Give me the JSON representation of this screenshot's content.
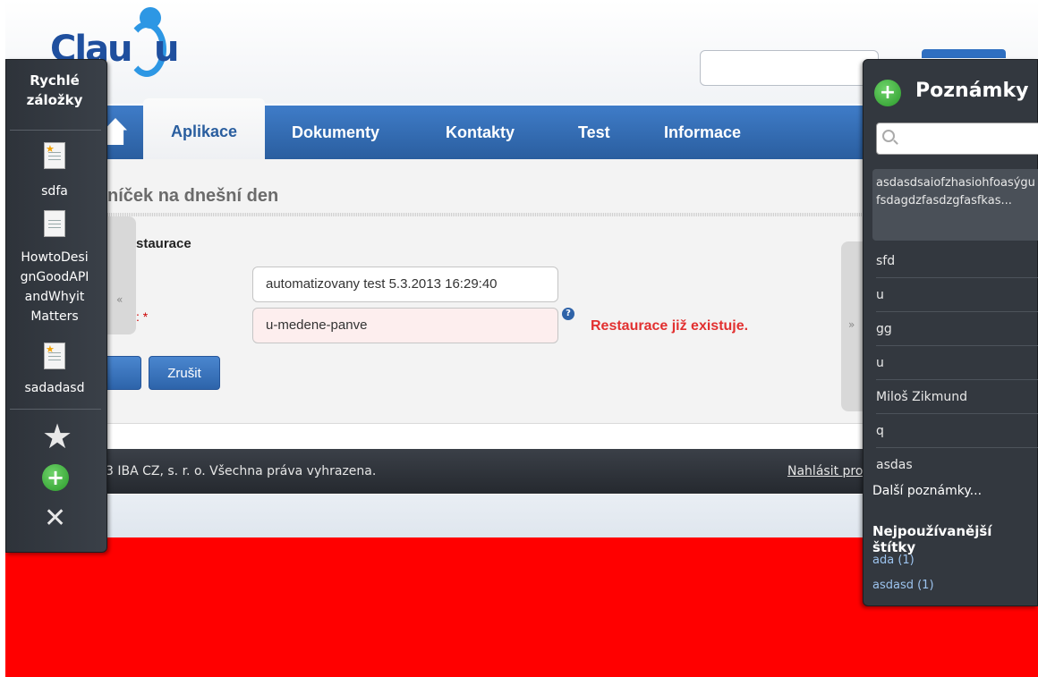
{
  "logo": {
    "text_left": "Clau",
    "text_right": "u"
  },
  "nav": {
    "tabs": [
      {
        "label": "Aplikace"
      },
      {
        "label": "Dokumenty"
      },
      {
        "label": "Kontakty"
      },
      {
        "label": "Test"
      },
      {
        "label": "Informace"
      }
    ]
  },
  "main": {
    "title": "níček na dnešní den",
    "section": "staurace",
    "required_suffix": ":",
    "required_mark": "*",
    "collapse_left_glyph": "«",
    "collapse_right_glyph": "»",
    "name_value": "automatizovany test 5.3.2013 16:29:40",
    "url_value": "u-medene-panve",
    "help_glyph": "?",
    "error_message": "Restaurace již existuje.",
    "cancel_label": "Zrušit"
  },
  "footer": {
    "copyright": "3 IBA CZ, s. r. o. Všechna práva vyhrazena.",
    "report_link": "Nahlásit pro"
  },
  "quick_bookmarks": {
    "title_line1": "Rychlé",
    "title_line2": "záložky",
    "items": [
      {
        "label": "sdfa",
        "icon": "starred-document-icon"
      },
      {
        "label_lines": [
          "HowtoDesi",
          "gnGoodAPI",
          "andWhyit",
          "Matters"
        ],
        "icon": "document-icon"
      },
      {
        "label": "sadadasd",
        "icon": "starred-document-icon"
      }
    ],
    "tools": [
      "star-icon",
      "add-icon",
      "tools-icon"
    ]
  },
  "notes": {
    "title": "Poznámky",
    "first_note": "asdasdsaiofzhasiohfoasýgufsdagdzfasdzgfasfkas...",
    "items": [
      "sfd",
      "u",
      "gg",
      "u",
      "Miloš Zikmund",
      "q",
      "asdas"
    ],
    "more_label": "Další poznámky...",
    "tags_title": "Nejpoužívanější štítky",
    "tags": [
      "ada (1)",
      "asdasd (1)"
    ]
  },
  "colors": {
    "nav_blue": "#3f7cc8",
    "error_red": "#e23030",
    "background_red": "#ff0000",
    "panel_dark": "#33383f"
  }
}
